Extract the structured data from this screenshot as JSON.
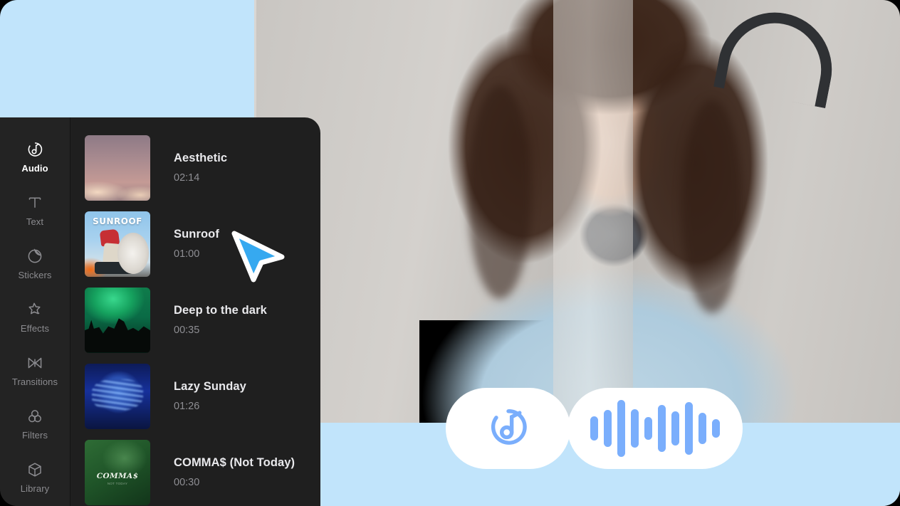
{
  "app": {
    "panel_name": "media-editor-panel",
    "theme_blue": "#c1e4fb",
    "accent_blue": "#7aaefc",
    "panel_bg": "#1f1f1f",
    "sidebar_bg": "#232323"
  },
  "sidebar": {
    "items": [
      {
        "label": "Audio",
        "icon": "audio-note-circle-icon",
        "active": true
      },
      {
        "label": "Text",
        "icon": "text-t-icon",
        "active": false
      },
      {
        "label": "Stickers",
        "icon": "sticker-circle-icon",
        "active": false
      },
      {
        "label": "Effects",
        "icon": "effects-sparkle-icon",
        "active": false
      },
      {
        "label": "Transitions",
        "icon": "transitions-bowtie-icon",
        "active": false
      },
      {
        "label": "Filters",
        "icon": "filters-circles-icon",
        "active": false
      },
      {
        "label": "Library",
        "icon": "library-cube-icon",
        "active": false
      }
    ]
  },
  "tracklist": {
    "name": "audio-track-list",
    "tracks": [
      {
        "title": "Aesthetic",
        "duration": "02:14",
        "art": "art-aesthetic",
        "art_alt": "pink sunset clouds album art"
      },
      {
        "title": "Sunroof",
        "duration": "01:00",
        "art": "art-sunroof",
        "art_alt": "SUNROOF album art",
        "art_word": "SUNROOF"
      },
      {
        "title": "Deep to the dark",
        "duration": "00:35",
        "art": "art-deep",
        "art_alt": "green concert silhouette album art"
      },
      {
        "title": "Lazy Sunday",
        "duration": "01:26",
        "art": "art-lazy",
        "art_alt": "blue blurred face album art"
      },
      {
        "title": "COMMA$ (Not Today)",
        "duration": "00:30",
        "art": "art-commas",
        "art_alt": "green COMMA$ album art",
        "art_word": "COMMA$",
        "art_sub": "NOT TODAY"
      }
    ]
  },
  "cursor": {
    "name": "pointer-cursor",
    "color": "#36a9f0"
  },
  "badges": {
    "note_pill": {
      "icon": "music-note-circle-icon",
      "color": "#7aaefc"
    },
    "wave_pill": {
      "icon": "audio-waveform-icon",
      "color": "#7aaefc",
      "bars": [
        34,
        52,
        80,
        54,
        32,
        66,
        48,
        74,
        44,
        26
      ]
    }
  }
}
